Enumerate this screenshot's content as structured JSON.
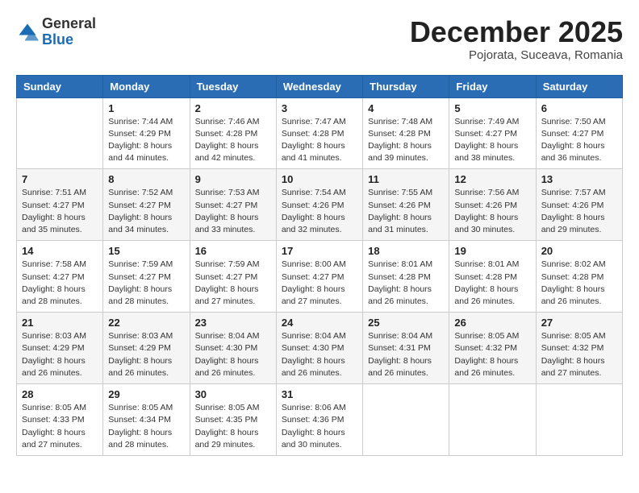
{
  "header": {
    "logo_line1": "General",
    "logo_line2": "Blue",
    "month": "December 2025",
    "location": "Pojorata, Suceava, Romania"
  },
  "weekdays": [
    "Sunday",
    "Monday",
    "Tuesday",
    "Wednesday",
    "Thursday",
    "Friday",
    "Saturday"
  ],
  "weeks": [
    [
      {
        "day": "",
        "info": ""
      },
      {
        "day": "1",
        "info": "Sunrise: 7:44 AM\nSunset: 4:29 PM\nDaylight: 8 hours\nand 44 minutes."
      },
      {
        "day": "2",
        "info": "Sunrise: 7:46 AM\nSunset: 4:28 PM\nDaylight: 8 hours\nand 42 minutes."
      },
      {
        "day": "3",
        "info": "Sunrise: 7:47 AM\nSunset: 4:28 PM\nDaylight: 8 hours\nand 41 minutes."
      },
      {
        "day": "4",
        "info": "Sunrise: 7:48 AM\nSunset: 4:28 PM\nDaylight: 8 hours\nand 39 minutes."
      },
      {
        "day": "5",
        "info": "Sunrise: 7:49 AM\nSunset: 4:27 PM\nDaylight: 8 hours\nand 38 minutes."
      },
      {
        "day": "6",
        "info": "Sunrise: 7:50 AM\nSunset: 4:27 PM\nDaylight: 8 hours\nand 36 minutes."
      }
    ],
    [
      {
        "day": "7",
        "info": "Sunrise: 7:51 AM\nSunset: 4:27 PM\nDaylight: 8 hours\nand 35 minutes."
      },
      {
        "day": "8",
        "info": "Sunrise: 7:52 AM\nSunset: 4:27 PM\nDaylight: 8 hours\nand 34 minutes."
      },
      {
        "day": "9",
        "info": "Sunrise: 7:53 AM\nSunset: 4:27 PM\nDaylight: 8 hours\nand 33 minutes."
      },
      {
        "day": "10",
        "info": "Sunrise: 7:54 AM\nSunset: 4:26 PM\nDaylight: 8 hours\nand 32 minutes."
      },
      {
        "day": "11",
        "info": "Sunrise: 7:55 AM\nSunset: 4:26 PM\nDaylight: 8 hours\nand 31 minutes."
      },
      {
        "day": "12",
        "info": "Sunrise: 7:56 AM\nSunset: 4:26 PM\nDaylight: 8 hours\nand 30 minutes."
      },
      {
        "day": "13",
        "info": "Sunrise: 7:57 AM\nSunset: 4:26 PM\nDaylight: 8 hours\nand 29 minutes."
      }
    ],
    [
      {
        "day": "14",
        "info": "Sunrise: 7:58 AM\nSunset: 4:27 PM\nDaylight: 8 hours\nand 28 minutes."
      },
      {
        "day": "15",
        "info": "Sunrise: 7:59 AM\nSunset: 4:27 PM\nDaylight: 8 hours\nand 28 minutes."
      },
      {
        "day": "16",
        "info": "Sunrise: 7:59 AM\nSunset: 4:27 PM\nDaylight: 8 hours\nand 27 minutes."
      },
      {
        "day": "17",
        "info": "Sunrise: 8:00 AM\nSunset: 4:27 PM\nDaylight: 8 hours\nand 27 minutes."
      },
      {
        "day": "18",
        "info": "Sunrise: 8:01 AM\nSunset: 4:28 PM\nDaylight: 8 hours\nand 26 minutes."
      },
      {
        "day": "19",
        "info": "Sunrise: 8:01 AM\nSunset: 4:28 PM\nDaylight: 8 hours\nand 26 minutes."
      },
      {
        "day": "20",
        "info": "Sunrise: 8:02 AM\nSunset: 4:28 PM\nDaylight: 8 hours\nand 26 minutes."
      }
    ],
    [
      {
        "day": "21",
        "info": "Sunrise: 8:03 AM\nSunset: 4:29 PM\nDaylight: 8 hours\nand 26 minutes."
      },
      {
        "day": "22",
        "info": "Sunrise: 8:03 AM\nSunset: 4:29 PM\nDaylight: 8 hours\nand 26 minutes."
      },
      {
        "day": "23",
        "info": "Sunrise: 8:04 AM\nSunset: 4:30 PM\nDaylight: 8 hours\nand 26 minutes."
      },
      {
        "day": "24",
        "info": "Sunrise: 8:04 AM\nSunset: 4:30 PM\nDaylight: 8 hours\nand 26 minutes."
      },
      {
        "day": "25",
        "info": "Sunrise: 8:04 AM\nSunset: 4:31 PM\nDaylight: 8 hours\nand 26 minutes."
      },
      {
        "day": "26",
        "info": "Sunrise: 8:05 AM\nSunset: 4:32 PM\nDaylight: 8 hours\nand 26 minutes."
      },
      {
        "day": "27",
        "info": "Sunrise: 8:05 AM\nSunset: 4:32 PM\nDaylight: 8 hours\nand 27 minutes."
      }
    ],
    [
      {
        "day": "28",
        "info": "Sunrise: 8:05 AM\nSunset: 4:33 PM\nDaylight: 8 hours\nand 27 minutes."
      },
      {
        "day": "29",
        "info": "Sunrise: 8:05 AM\nSunset: 4:34 PM\nDaylight: 8 hours\nand 28 minutes."
      },
      {
        "day": "30",
        "info": "Sunrise: 8:05 AM\nSunset: 4:35 PM\nDaylight: 8 hours\nand 29 minutes."
      },
      {
        "day": "31",
        "info": "Sunrise: 8:06 AM\nSunset: 4:36 PM\nDaylight: 8 hours\nand 30 minutes."
      },
      {
        "day": "",
        "info": ""
      },
      {
        "day": "",
        "info": ""
      },
      {
        "day": "",
        "info": ""
      }
    ]
  ]
}
